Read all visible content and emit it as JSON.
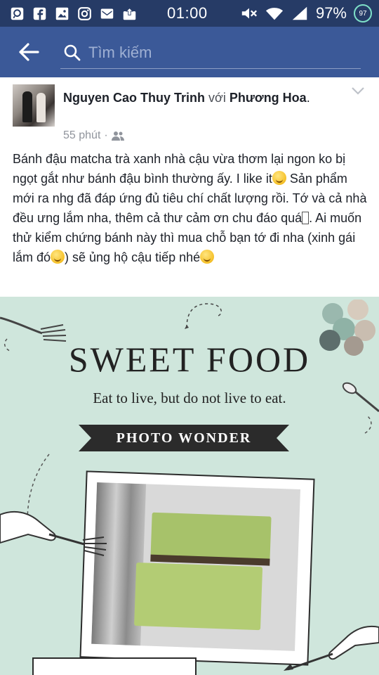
{
  "status_bar": {
    "time": "01:00",
    "battery_percent": "97%",
    "battery_badge": "97",
    "icons": [
      "notification-icon",
      "facebook-icon",
      "gallery-icon",
      "instagram-icon",
      "gmail-icon",
      "upload-icon",
      "mute-icon",
      "wifi-icon",
      "signal-icon",
      "battery-icon"
    ]
  },
  "app_bar": {
    "search_placeholder": "Tìm kiếm"
  },
  "post": {
    "author": "Nguyen Cao Thuy Trinh",
    "with_text": "với",
    "tagged": "Phương Hoa",
    "tagged_suffix": ".",
    "time": "55 phút",
    "separator": "·",
    "audience_icon": "friends-icon",
    "text_p1": "Bánh đậu matcha trà xanh nhà cậu vừa thơm lại ngon ko bị ngọt gắt như bánh đậu bình thường ấy. I like it",
    "text_p2": "Sản phẩm mới ra nhg đã đáp ứng đủ tiêu chí chất lượng rồi. Tớ và cả nhà đều ưng lắm nha, thêm cả thư cảm ơn chu đáo quá",
    "text_p3": ". Ai muốn thử kiểm chứng bánh này thì mua chỗ bạn tớ đi nha (xinh gái lắm đó",
    "text_p4": ") sẽ ủng hộ cậu tiếp nhé",
    "image": {
      "title": "SWEET FOOD",
      "subtitle": "Eat to live, but do not live to eat.",
      "banner": "PHOTO WONDER"
    }
  },
  "colors": {
    "status_bar": "#263b66",
    "app_bar": "#3b5998",
    "image_bg": "#cfe6dc"
  }
}
